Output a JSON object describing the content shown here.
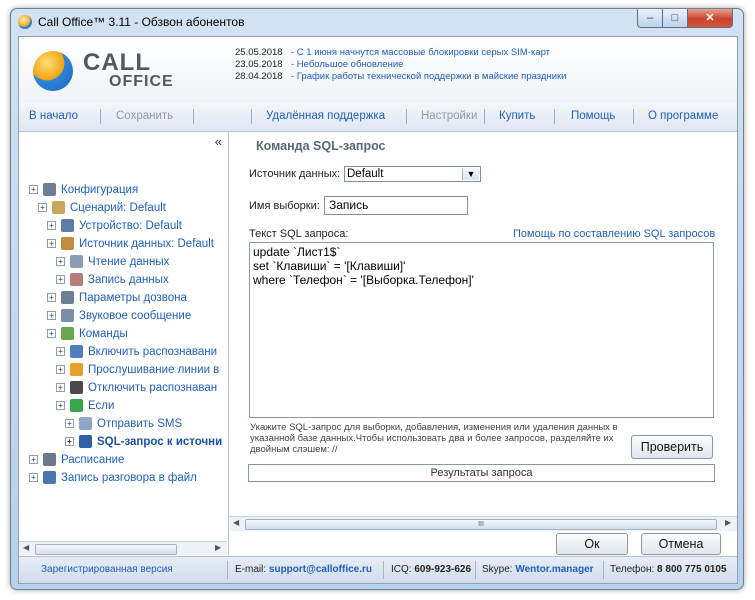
{
  "window": {
    "title": "Call Office™ 3.11 - Обзвон абонентов",
    "controls": {
      "minimize": "–",
      "maximize": "□",
      "close": "✕"
    }
  },
  "logo": {
    "line1": "CALL",
    "line2": "OFFICE"
  },
  "news": [
    {
      "date": "25.05.2018",
      "text": "- С 1 июня начнутся массовые блокировки серых SIM-карт"
    },
    {
      "date": "23.05.2018",
      "text": "- Небольшое обновление"
    },
    {
      "date": "28.04.2018",
      "text": "- График работы технической поддержки в майские праздники"
    }
  ],
  "toolbar": {
    "home": "В начало",
    "save": "Сохранить",
    "remote": "Удалённая поддержка",
    "settings": "Настройки",
    "buy": "Купить",
    "help": "Помощь",
    "about": "О программе"
  },
  "tree": {
    "collapse": "«",
    "items": [
      {
        "label": "Конфигурация",
        "icon": "gear-icon",
        "color": "#6b7f96"
      },
      {
        "label": "Сценарий: Default",
        "icon": "script-icon",
        "color": "#c7a85a"
      },
      {
        "label": "Устройство: Default",
        "icon": "device-icon",
        "color": "#5d7da8"
      },
      {
        "label": "Источник данных: Default",
        "icon": "database-icon",
        "color": "#c48a3e"
      },
      {
        "label": "Чтение данных",
        "icon": "read-data-icon",
        "color": "#8a9db4"
      },
      {
        "label": "Запись данных",
        "icon": "write-data-icon",
        "color": "#b97c7c"
      },
      {
        "label": "Параметры дозвона",
        "icon": "dial-settings-icon",
        "color": "#6b7f96"
      },
      {
        "label": "Звуковое сообщение",
        "icon": "speaker-icon",
        "color": "#7a8fa6"
      },
      {
        "label": "Команды",
        "icon": "commands-icon",
        "color": "#6aa84f"
      },
      {
        "label": "Включить распознавани",
        "icon": "recognition-on-icon",
        "color": "#4e7fc0"
      },
      {
        "label": "Прослушивание линии в",
        "icon": "listen-icon",
        "color": "#e3a32a"
      },
      {
        "label": "Отключить распознаван",
        "icon": "recognition-off-icon",
        "color": "#4a4a4a"
      },
      {
        "label": "Если",
        "icon": "condition-icon",
        "color": "#3aa64a"
      },
      {
        "label": "Отправить SMS",
        "icon": "sms-icon",
        "color": "#8fa7c6"
      },
      {
        "label": "SQL-запрос к источни",
        "icon": "sql-icon",
        "color": "#2f5fa8"
      },
      {
        "label": "Расписание",
        "icon": "clock-icon",
        "color": "#6a7a8c"
      },
      {
        "label": "Запись разговора в файл",
        "icon": "mic-icon",
        "color": "#4a77b0"
      }
    ]
  },
  "form": {
    "title": "Команда SQL-запрос",
    "source_label": "Источник данных:",
    "source_value": "Default",
    "selection_label": "Имя выборки:",
    "selection_value": "Запись",
    "sql_label": "Текст SQL запроса:",
    "sql_help_link": "Помощь по составлению SQL запросов",
    "sql_lines": [
      "update `Лист1$`",
      "set `Клавиши` = '[Клавиши]'",
      "where `Телефон` = '[Выборка.Телефон]'"
    ],
    "hint": "Укажите SQL-запрос для выборки, добавления, изменения или удаления данных в указанной базе данных.Чтобы использовать два и более запросов, разделяйте их двойным слэшем: //",
    "check_button": "Проверить",
    "results_button": "Результаты запроса",
    "ok_button": "Ок",
    "cancel_button": "Отмена",
    "scroll_grip": "III"
  },
  "status": {
    "registered": "Зарегистрированная версия",
    "email_label": "E-mail:",
    "email": "support@calloffice.ru",
    "icq_label": "ICQ:",
    "icq": "609-923-626",
    "skype_label": "Skype:",
    "skype": "Wentor.manager",
    "phone_label": "Телефон:",
    "phone": "8 800 775 0105"
  },
  "colors": {
    "link": "#1f5fbf",
    "title_bar": "#c9dcf0",
    "close": "#c9422b"
  }
}
